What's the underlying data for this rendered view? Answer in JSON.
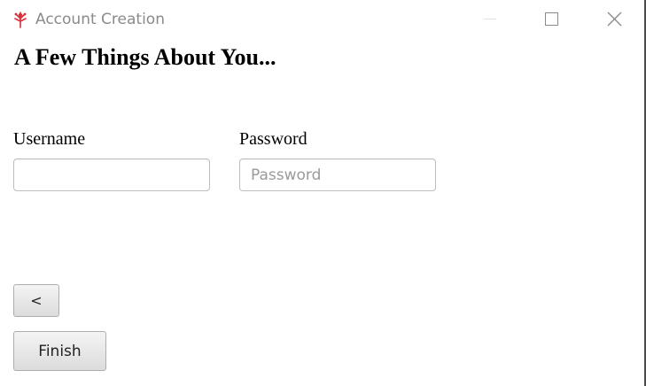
{
  "window": {
    "title": "Account Creation",
    "icon": "tree-logo-icon",
    "controls": [
      "minimize-icon",
      "maximize-icon",
      "close-icon"
    ]
  },
  "page": {
    "heading": "A Few Things About You..."
  },
  "form": {
    "username": {
      "label": "Username",
      "value": "",
      "placeholder": ""
    },
    "password": {
      "label": "Password",
      "value": "",
      "placeholder": "Password"
    }
  },
  "buttons": {
    "back_label": "<",
    "finish_label": "Finish"
  },
  "colors": {
    "accent_icon": "#d9303a",
    "title_text": "#8a8a8a",
    "input_border": "#bdbdbd"
  }
}
